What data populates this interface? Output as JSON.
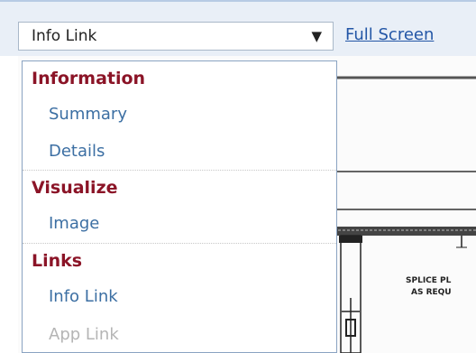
{
  "toolbar": {
    "selected_view": "Info Link",
    "dropdown_arrow": "▼",
    "full_screen_link": "Full Screen"
  },
  "dropdown": {
    "groups": [
      {
        "label": "Information",
        "items": [
          "Summary",
          "Details"
        ]
      },
      {
        "label": "Visualize",
        "items": [
          "Image"
        ]
      },
      {
        "label": "Links",
        "items": [
          "Info Link",
          "App Link"
        ]
      }
    ]
  },
  "drawing": {
    "note_line1": "SPLICE PL",
    "note_line2": "AS REQU"
  },
  "colors": {
    "group_header": "#8b1427",
    "menu_item": "#3c6fa3",
    "menu_item_disabled": "#b5b5b5",
    "link": "#2356a6"
  }
}
